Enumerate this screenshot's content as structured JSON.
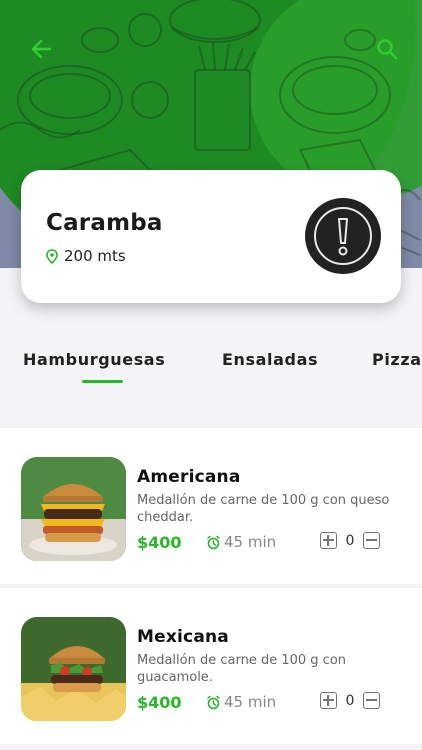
{
  "colors": {
    "brand_green": "#27b82a",
    "banner_green": "#1e8a24",
    "banner_gray": "#7e8aa6"
  },
  "header": {
    "back_icon": "arrow-left-icon",
    "search_icon": "search-icon"
  },
  "restaurant": {
    "name": "Caramba",
    "distance": "200 mts",
    "distance_icon": "location-pin-icon",
    "badge_icon": "exclamation-icon"
  },
  "tabs": [
    {
      "label": "Hamburguesas",
      "active": true
    },
    {
      "label": "Ensaladas",
      "active": false
    },
    {
      "label": "Pizza",
      "active": false
    }
  ],
  "products": [
    {
      "name": "Americana",
      "description": "Medallón de carne de 100 g con queso cheddar.",
      "price": "$400",
      "time": "45 min",
      "quantity": "0",
      "image": "burger-photo"
    },
    {
      "name": "Mexicana",
      "description": "Medallón de carne de 100 g con guacamole.",
      "price": "$400",
      "time": "45 min",
      "quantity": "0",
      "image": "burger-photo"
    }
  ]
}
